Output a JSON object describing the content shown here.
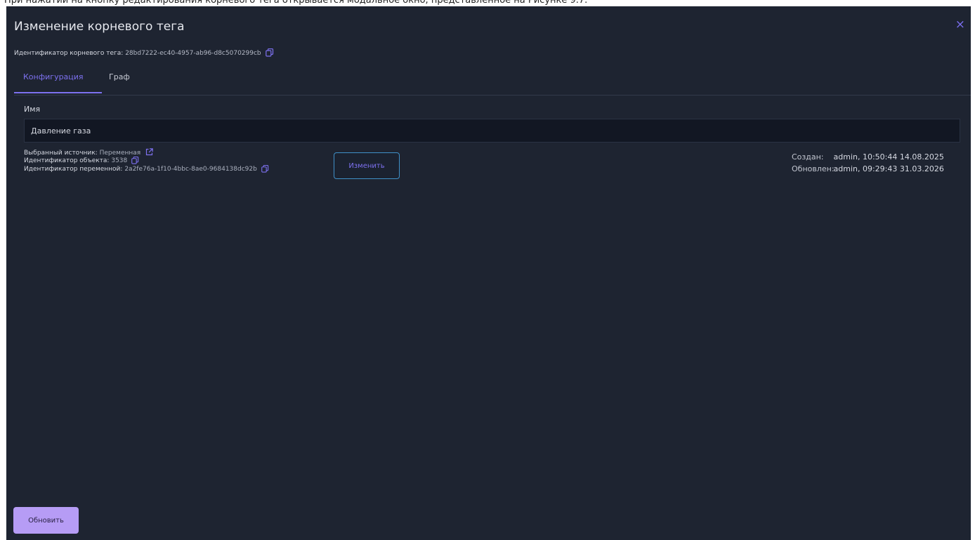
{
  "caption": "При нажатии на кнопку редактирования корневого тега открывается модальное окно, представленное на Рисунке 9.7.",
  "modal": {
    "title": "Изменение корневого тега",
    "close_glyph": "×",
    "root_tag_id_label": "Идентификатор корневого тега:",
    "root_tag_id_value": "28bd7222-ec40-4957-ab96-d8c5070299cb"
  },
  "tabs": [
    {
      "label": "Конфигурация",
      "active": true
    },
    {
      "label": "Граф",
      "active": false
    }
  ],
  "form": {
    "name_label": "Имя",
    "name_value": "Давление газа"
  },
  "source": {
    "selected_source_label": "Выбранный источник:",
    "selected_source_value": "Переменная",
    "object_id_label": "Идентификатор объекта:",
    "object_id_value": "3538",
    "variable_id_label": "Идентификатор переменной:",
    "variable_id_value": "2a2fe76a-1f10-4bbc-8ae0-9684138dc92b",
    "change_button": "Изменить"
  },
  "meta": {
    "created_label": "Создан:",
    "created_value": "admin, 10:50:44 14.08.2025",
    "updated_label": "Обновлен:",
    "updated_value": "admin, 09:29:43 31.03.2026"
  },
  "footer": {
    "update_button": "Обновить"
  },
  "icons": {
    "copy": "copy-icon",
    "external_link": "external-link-icon",
    "close": "close-icon"
  },
  "colors": {
    "modal_bg": "#1e2431",
    "accent": "#7d71f0",
    "input_bg": "#121723",
    "primary_button": "#b69cf5",
    "outline_button_border": "#3f90c8"
  }
}
